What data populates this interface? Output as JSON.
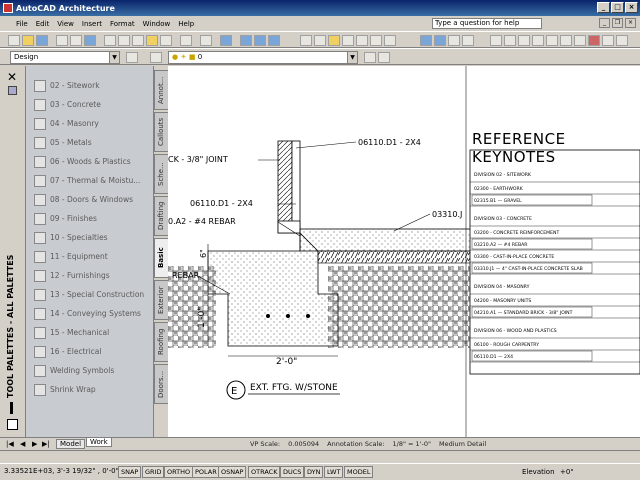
{
  "titlebar": {
    "title": "AutoCAD Architecture"
  },
  "menubar": {
    "items": [
      "File",
      "Edit",
      "View",
      "Insert",
      "Format",
      "Window",
      "Help"
    ],
    "help_placeholder": "Type a question for help"
  },
  "toolbar2": {
    "workspace": "Design",
    "layer": "0"
  },
  "palette": {
    "title": "TOOL PALETTES - ALL PALETTES",
    "items": [
      "02 - Sitework",
      "03 - Concrete",
      "04 - Masonry",
      "05 - Metals",
      "06 - Woods & Plastics",
      "07 - Thermal & Moistu...",
      "08 - Doors & Windows",
      "09 - Finishes",
      "10 - Specialties",
      "11 - Equipment",
      "12 - Furnishings",
      "13 - Special Construction",
      "14 - Conveying Systems",
      "15 - Mechanical",
      "16 - Electrical",
      "Welding Symbols",
      "Shrink Wrap"
    ],
    "tabs": [
      "Annot...",
      "Callouts",
      "Sche...",
      "Drafting",
      "Basic",
      "Exterior",
      "Roofing",
      "Doors..."
    ],
    "active_tab": "Basic"
  },
  "drawing": {
    "labels": {
      "ck_joint": "CK - 3/8\" JOINT",
      "ref1": "06110.D1 - 2X4",
      "ref2": "06110.D1 - 2X4",
      "rebar_tag": "0.A2 - #4 REBAR",
      "ref3": "03310.J",
      "rebar": "REBAR",
      "dim_6": "6\"",
      "dim_1ft": "1'-0\"",
      "dim_2ft": "2'-0\"",
      "bubble": "E",
      "detail_title": "EXT. FTG. W/STONE"
    },
    "keynotes": {
      "title": "REFERENCE KEYNOTES",
      "rows": [
        {
          "kind": "division",
          "text": "DIVISION 02 - SITEWORK"
        },
        {
          "kind": "section",
          "text": "02300 - EARTHWORK"
        },
        {
          "kind": "item",
          "code": "02315.B1",
          "desc": "GRAVEL"
        },
        {
          "kind": "division",
          "text": "DIVISION 03 - CONCRETE"
        },
        {
          "kind": "section",
          "text": "03200 - CONCRETE REINFORCEMENT"
        },
        {
          "kind": "item",
          "code": "03210.A2",
          "desc": "#4 REBAR"
        },
        {
          "kind": "section",
          "text": "03300 - CAST-IN-PLACE CONCRETE"
        },
        {
          "kind": "item",
          "code": "03310.J1",
          "desc": "4\" CAST-IN-PLACE CONCRETE SLAB"
        },
        {
          "kind": "division",
          "text": "DIVISION 04 - MASONRY"
        },
        {
          "kind": "section",
          "text": "04200 - MASONRY UNITS"
        },
        {
          "kind": "item",
          "code": "04210.A1",
          "desc": "STANDARD BRICK - 3/8\" JOINT"
        },
        {
          "kind": "division",
          "text": "DIVISION 06 - WOOD AND PLASTICS"
        },
        {
          "kind": "section",
          "text": "06100 - ROUGH CARPENTRY"
        },
        {
          "kind": "item",
          "code": "06110.D1",
          "desc": "2X4"
        }
      ]
    }
  },
  "layout_tabs": {
    "model": "Model",
    "work": "Work"
  },
  "scale": {
    "vp_label": "VP Scale:",
    "vp_value": "0.005094",
    "ann_label": "Annotation Scale:",
    "ann_value": "1/8\" = 1'-0\"",
    "detail": "Medium Detail"
  },
  "status": {
    "coords": "3.33521E+03, 3'-3 19/32\" , 0'-0\"",
    "toggles": [
      "SNAP",
      "GRID",
      "ORTHO",
      "POLAR",
      "OSNAP",
      "OTRACK",
      "DUCS",
      "DYN",
      "LWT",
      "MODEL"
    ],
    "elevation_label": "Elevation",
    "elevation_value": "+0\""
  }
}
